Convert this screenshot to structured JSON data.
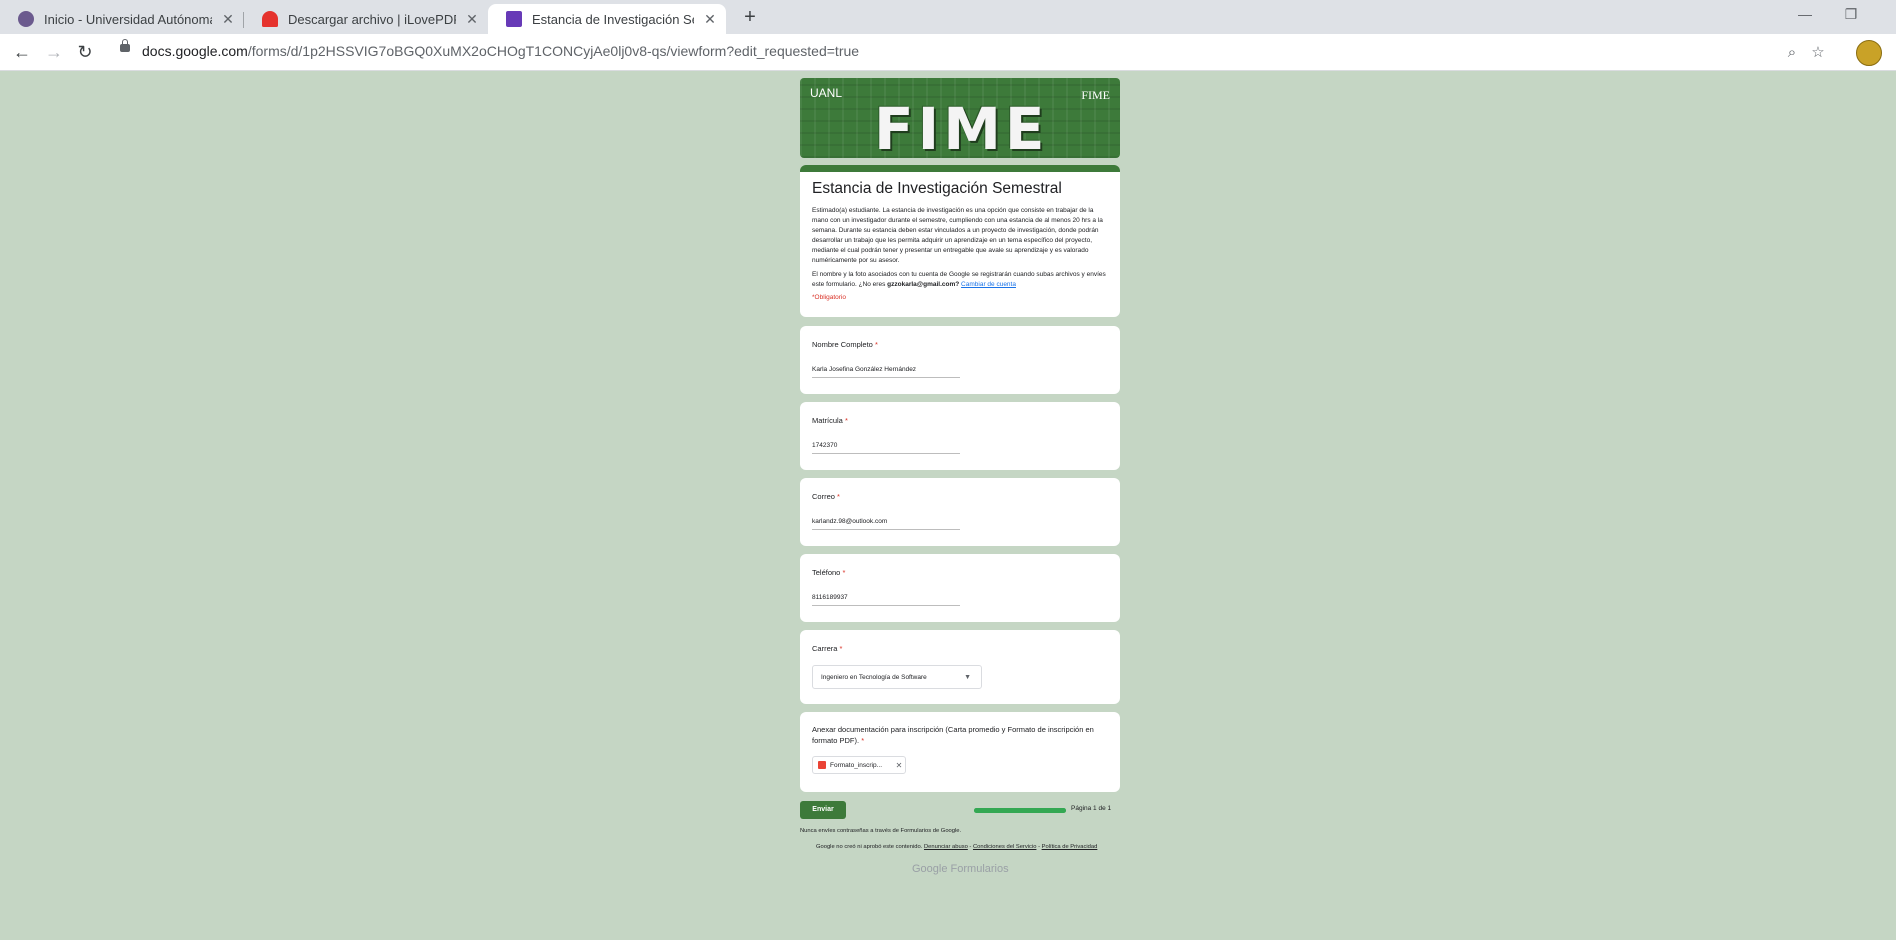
{
  "tabs": [
    {
      "title": "Inicio - Universidad Autónoma d",
      "icon": "university-seal-icon"
    },
    {
      "title": "Descargar archivo | iLovePDF",
      "icon": "ilovepdf-heart-icon"
    },
    {
      "title": "Estancia de Investigación Semest",
      "icon": "google-forms-icon",
      "active": true
    }
  ],
  "address": {
    "domain": "docs.google.com",
    "path": "/forms/d/1p2HSSVIG7oBGQ0XuMX2oCHOgT1CONCyjAe0lj0v8-qs/viewform?edit_requested=true"
  },
  "banner": {
    "main": "FIME",
    "left_logo": "UANL",
    "right_logo": "FIME"
  },
  "form": {
    "title": "Estancia de Investigación Semestral",
    "description": "Estimado(a) estudiante. La estancia de investigación es una opción que consiste en trabajar de la mano con un investigador durante el semestre, cumpliendo con una estancia de al menos 20 hrs a la semana. Durante su estancia deben estar vinculados a un proyecto de investigación, donde podrán desarrollar un trabajo que les permita adquirir un aprendizaje en un tema específico del proyecto, mediante el cual podrán tener y presentar un entregable que avale su aprendizaje y es valorado numéricamente por su asesor.",
    "account_note": "El nombre y la foto asociados con tu cuenta de Google se registrarán cuando subas archivos y envíes este formulario. ¿No eres",
    "account_email": "gzzokarla@gmail.com?",
    "switch_account": "Cambiar de cuenta",
    "required_note": "*Obligatorio"
  },
  "questions": [
    {
      "label": "Nombre Completo",
      "value": "Karla Josefina González Hernández"
    },
    {
      "label": "Matrícula",
      "value": "1742370"
    },
    {
      "label": "Correo",
      "value": "karlandz.98@outlook.com"
    },
    {
      "label": "Teléfono",
      "value": "8116189937"
    },
    {
      "label": "Carrera",
      "value": "Ingeniero en Tecnología de Software"
    },
    {
      "label": "Anexar documentación para inscripción (Carta promedio y Formato de inscripción en formato PDF).",
      "value": "Formato_inscrip..."
    }
  ],
  "required_mark": "*",
  "submit_label": "Enviar",
  "progress": {
    "text": "Página 1 de 1",
    "fraction": 1.0
  },
  "footer": {
    "line1": "Nunca envíes contraseñas a través de Formularios de Google.",
    "line2_prefix": "Google no creó ni aprobó este contenido.",
    "report": "Denunciar abuso",
    "terms": "Condiciones del Servicio",
    "privacy": "Política de Privacidad",
    "sep": " - ",
    "brand_google": "Google",
    "brand_forms": "Formularios"
  },
  "colors": {
    "theme": "#3d7a3a",
    "page_bg": "#c5d6c4",
    "required": "#d93025"
  }
}
